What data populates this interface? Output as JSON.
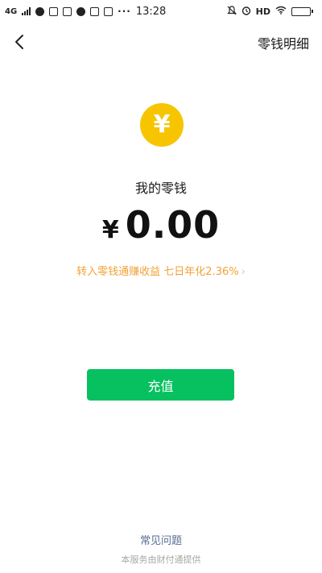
{
  "status_bar": {
    "network": "4G",
    "dots": "···",
    "time": "13:28",
    "hd": "HD"
  },
  "nav": {
    "right_label": "零钱明细"
  },
  "coin": {
    "symbol": "¥"
  },
  "main": {
    "title": "我的零钱",
    "currency": "¥",
    "amount": "0.00",
    "promo": "转入零钱通赚收益 七日年化2.36%",
    "promo_chevron": "›",
    "recharge_label": "充值"
  },
  "footer": {
    "faq": "常见问题",
    "provider": "本服务由财付通提供"
  },
  "colors": {
    "coin": "#f6c500",
    "primary_button": "#07c160",
    "promo_text": "#f2a136",
    "link": "#576b95"
  }
}
